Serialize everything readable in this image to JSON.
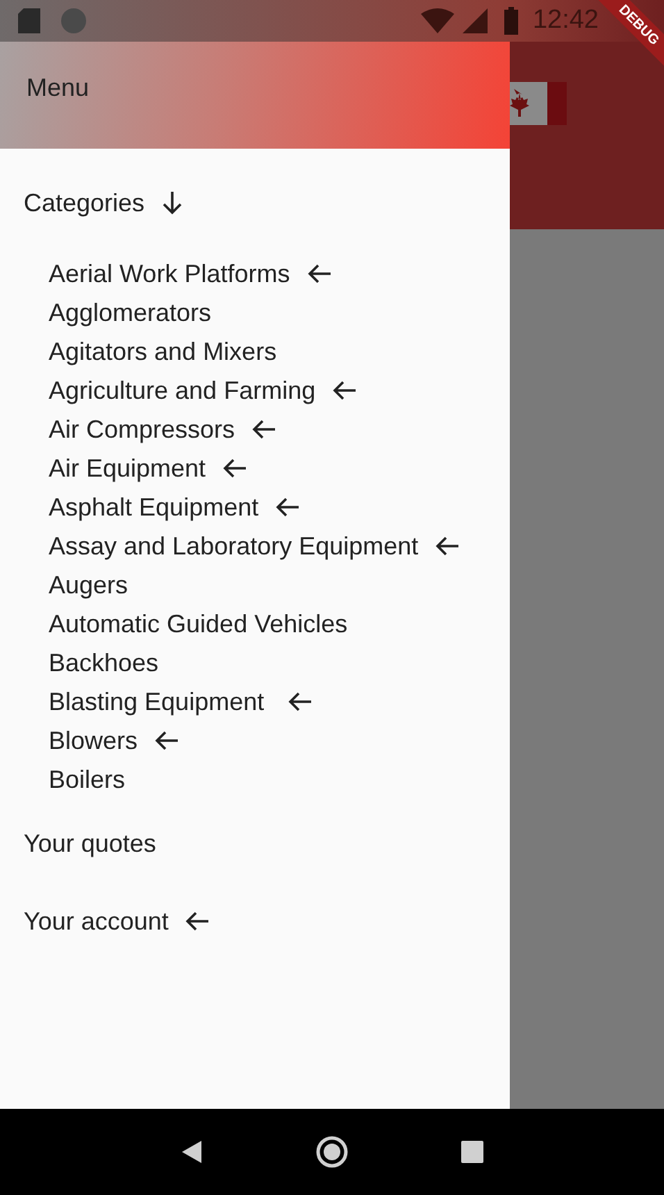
{
  "status_bar": {
    "time": "12:42"
  },
  "drawer": {
    "header": {
      "title": "Menu"
    },
    "categories": {
      "label": "Categories",
      "expanded": true,
      "items": [
        {
          "label": "Aerial Work Platforms",
          "arrow": true
        },
        {
          "label": "Agglomerators",
          "arrow": false
        },
        {
          "label": "Agitators and Mixers",
          "arrow": false
        },
        {
          "label": "Agriculture and Farming",
          "arrow": true
        },
        {
          "label": "Air Compressors",
          "arrow": true
        },
        {
          "label": "Air Equipment",
          "arrow": true
        },
        {
          "label": "Asphalt Equipment",
          "arrow": true
        },
        {
          "label": "Assay and Laboratory Equipment",
          "arrow": true
        },
        {
          "label": "Augers",
          "arrow": false
        },
        {
          "label": "Automatic Guided Vehicles",
          "arrow": false
        },
        {
          "label": "Backhoes",
          "arrow": false
        },
        {
          "label": "Blasting Equipment ",
          "arrow": true
        },
        {
          "label": "Blowers",
          "arrow": true
        },
        {
          "label": "Boilers",
          "arrow": false
        }
      ]
    },
    "links": [
      {
        "label": "Your quotes",
        "arrow": false
      },
      {
        "label": "Your account",
        "arrow": true
      }
    ]
  },
  "debug_banner": "DEBUG"
}
